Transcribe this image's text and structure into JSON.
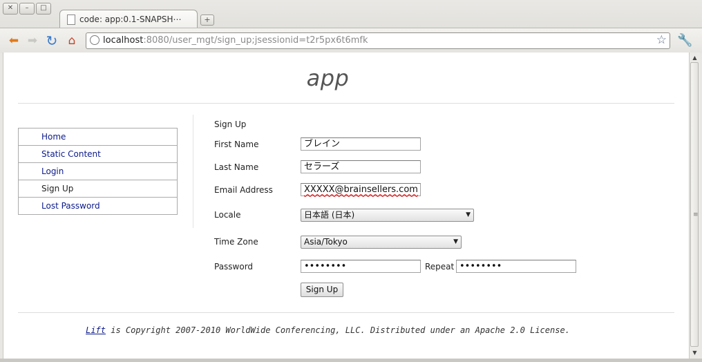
{
  "window": {
    "buttons": [
      "✕",
      "–",
      "□"
    ]
  },
  "tab": {
    "title": "code: app:0.1-SNAPSH⋯",
    "new_tab_symbol": "+"
  },
  "toolbar": {
    "back_icon": "back-arrow-icon",
    "forward_icon": "forward-arrow-icon",
    "reload_icon": "reload-icon",
    "home_icon": "home-icon",
    "url_host": "localhost",
    "url_rest": ":8080/user_mgt/sign_up;jsessionid=t2r5px6t6mfk"
  },
  "page": {
    "title": "app",
    "sidebar": [
      {
        "label": "Home",
        "current": false
      },
      {
        "label": "Static Content",
        "current": false
      },
      {
        "label": "Login",
        "current": false
      },
      {
        "label": "Sign Up",
        "current": true
      },
      {
        "label": "Lost Password",
        "current": false
      }
    ],
    "form": {
      "heading": "Sign Up",
      "first_name_label": "First Name",
      "first_name_value": "ブレイン",
      "last_name_label": "Last Name",
      "last_name_value": "セラーズ",
      "email_label": "Email Address",
      "email_value": "XXXXX@brainsellers.com",
      "locale_label": "Locale",
      "locale_value": "日本語 (日本)",
      "timezone_label": "Time Zone",
      "timezone_value": "Asia/Tokyo",
      "password_label": "Password",
      "password_value": "••••••••",
      "repeat_label": "Repeat",
      "repeat_value": "••••••••",
      "submit_label": "Sign Up"
    },
    "footer": {
      "link_text": "Lift",
      "text": " is Copyright 2007-2010 WorldWide Conferencing, LLC. Distributed under an Apache 2.0 License."
    }
  },
  "colors": {
    "link": "#0b1a8a",
    "title": "#555555"
  }
}
